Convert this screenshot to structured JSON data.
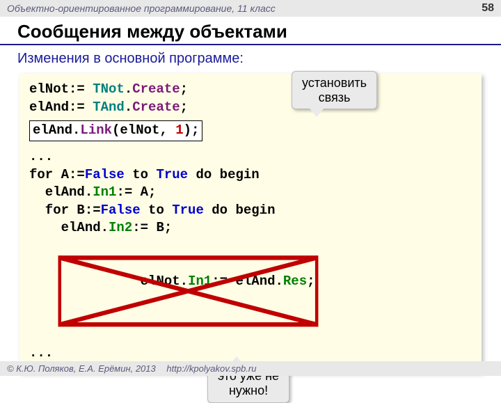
{
  "header": {
    "course": "Объектно-ориентированное программирование, 11 класс",
    "page": "58"
  },
  "title": "Сообщения между объектами",
  "subtitle": "Изменения в основной программе:",
  "callouts": {
    "link": "установить\nсвязь",
    "removed": "это уже не\nнужно!"
  },
  "code": {
    "l1_a": "elNot:= ",
    "l1_b": "TNot",
    "l1_c": ".",
    "l1_d": "Create",
    "l1_e": ";",
    "l2_a": "elAnd:= ",
    "l2_b": "TAnd",
    "l2_c": ".",
    "l2_d": "Create",
    "l2_e": ";",
    "l3_a": "elAnd.",
    "l3_b": "Link",
    "l3_c": "(elNot, ",
    "l3_d": "1",
    "l3_e": ");",
    "l4": "...",
    "l5_a": "for A:=",
    "l5_b": "False",
    "l5_c": " to ",
    "l5_d": "True",
    "l5_e": " do begin",
    "l6_a": "  elAnd.",
    "l6_b": "In1",
    "l6_c": ":= A;",
    "l7_a": "  for B:=",
    "l7_b": "False",
    "l7_c": " to ",
    "l7_d": "True",
    "l7_e": " do begin",
    "l8_a": "    elAnd.",
    "l8_b": "In2",
    "l8_c": ":= B;",
    "l9_a": "    elNot.",
    "l9_b": "In1",
    "l9_c": ":= elAnd.",
    "l9_d": "Res",
    "l9_e": ";",
    "l10": "..."
  },
  "footer": {
    "copyright": "© К.Ю. Поляков, Е.А. Ерёмин, 2013",
    "url": "http://kpolyakov.spb.ru"
  }
}
